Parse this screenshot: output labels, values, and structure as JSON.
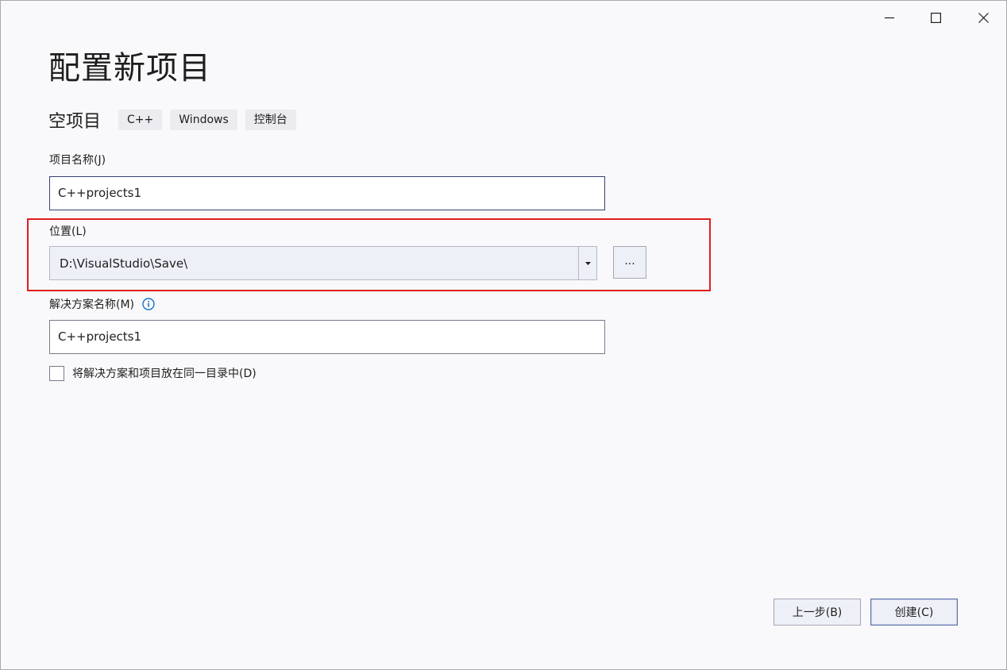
{
  "window": {
    "title": "配置新项目",
    "controls": {
      "minimize": "minimize-icon",
      "maximize": "maximize-icon",
      "close": "close-icon"
    }
  },
  "template": {
    "name": "空项目",
    "tags": [
      "C++",
      "Windows",
      "控制台"
    ]
  },
  "project_name": {
    "label": "项目名称(J)",
    "value": "C++projects1"
  },
  "location": {
    "label": "位置(L)",
    "value": "D:\\VisualStudio\\Save\\",
    "browse_label": "...",
    "highlighted": true
  },
  "solution_name": {
    "label": "解决方案名称(M)",
    "value": "C++projects1",
    "info_icon": "info-icon"
  },
  "same_directory": {
    "label": "将解决方案和项目放在同一目录中(D)",
    "checked": false
  },
  "buttons": {
    "back": "上一步(B)",
    "create": "创建(C)"
  },
  "colors": {
    "highlight_border": "#e01d1d",
    "info_accent": "#1a73c8",
    "background": "#f9f9fb"
  }
}
